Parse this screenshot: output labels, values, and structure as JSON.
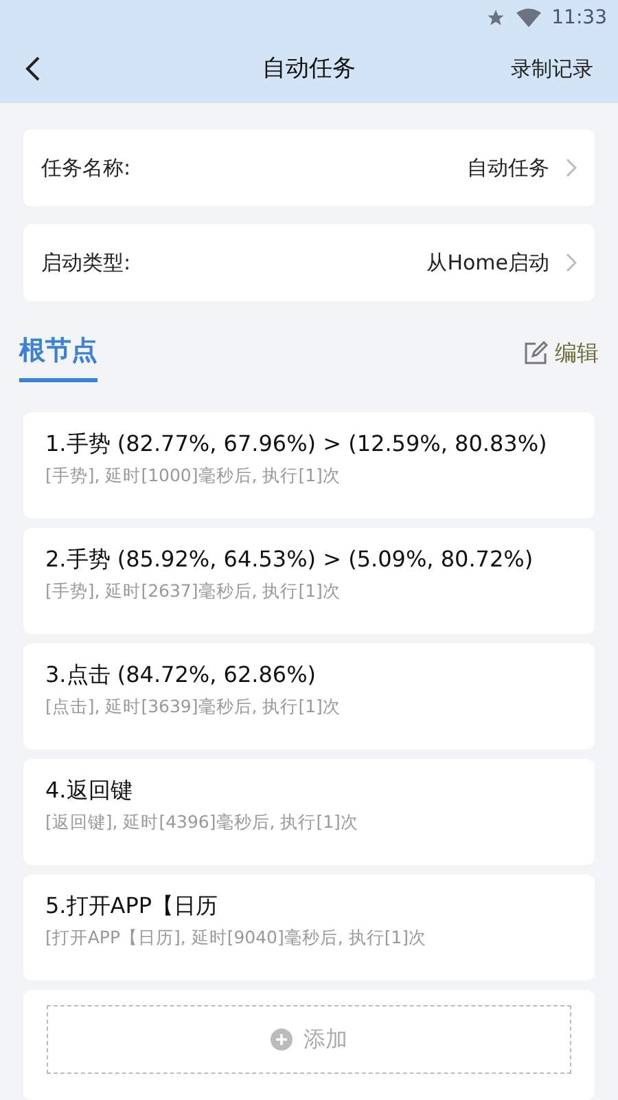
{
  "status_bar": {
    "time": "11:33"
  },
  "header": {
    "title": "自动任务",
    "action": "录制记录"
  },
  "settings": [
    {
      "label": "任务名称:",
      "value": "自动任务"
    },
    {
      "label": "启动类型:",
      "value": "从Home启动"
    }
  ],
  "tabs": [
    {
      "label": "根节点",
      "selected": true
    }
  ],
  "edit_button": "编辑",
  "nodes": [
    {
      "title": "1.手势 (82.77%, 67.96%) > (12.59%, 80.83%)",
      "detail": "[手势], 延时[1000]毫秒后, 执行[1]次"
    },
    {
      "title": "2.手势 (85.92%, 64.53%) > (5.09%, 80.72%)",
      "detail": "[手势], 延时[2637]毫秒后, 执行[1]次"
    },
    {
      "title": "3.点击 (84.72%, 62.86%)",
      "detail": "[点击], 延时[3639]毫秒后, 执行[1]次"
    },
    {
      "title": "4.返回键",
      "detail": "[返回键], 延时[4396]毫秒后, 执行[1]次"
    },
    {
      "title": "5.打开APP【日历",
      "detail": "[打开APP【日历], 延时[9040]毫秒后, 执行[1]次"
    }
  ],
  "add_button": "添加"
}
